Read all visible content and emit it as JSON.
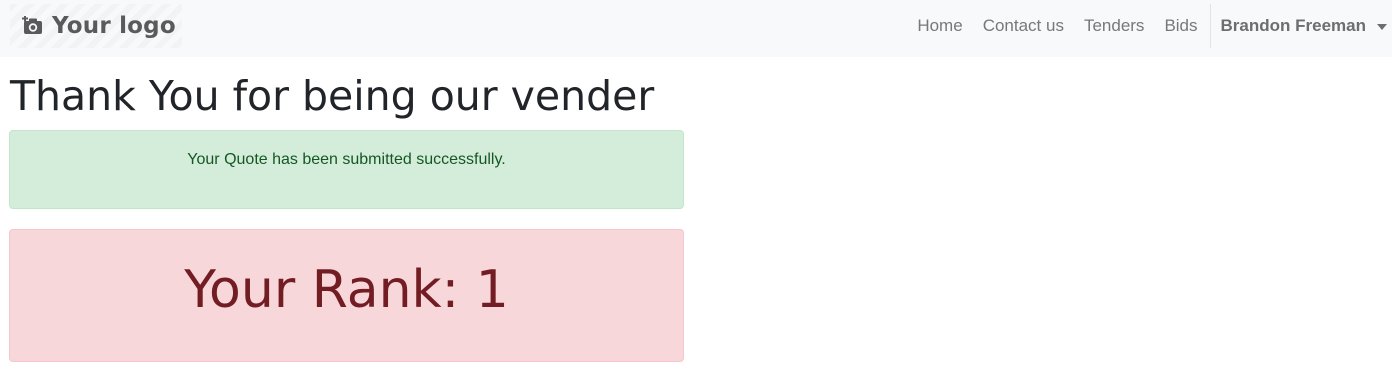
{
  "navbar": {
    "brand": {
      "icon": "camera-add-icon",
      "label": "Your logo"
    },
    "links": [
      {
        "label": "Home"
      },
      {
        "label": "Contact us"
      },
      {
        "label": "Tenders"
      },
      {
        "label": "Bids"
      }
    ],
    "user": {
      "name": "Brandon Freeman",
      "icon": "chevron-down-icon"
    }
  },
  "main": {
    "title": "Thank You for being our vender",
    "success_alert": {
      "message": "Your Quote has been submitted successfully."
    },
    "rank_alert": {
      "text": "Your Rank: 1"
    }
  },
  "colors": {
    "navbar_bg": "#f8f9fa",
    "success_bg": "#d4edda",
    "success_text": "#155724",
    "danger_bg": "#f8d7da",
    "danger_text": "#721c24"
  }
}
